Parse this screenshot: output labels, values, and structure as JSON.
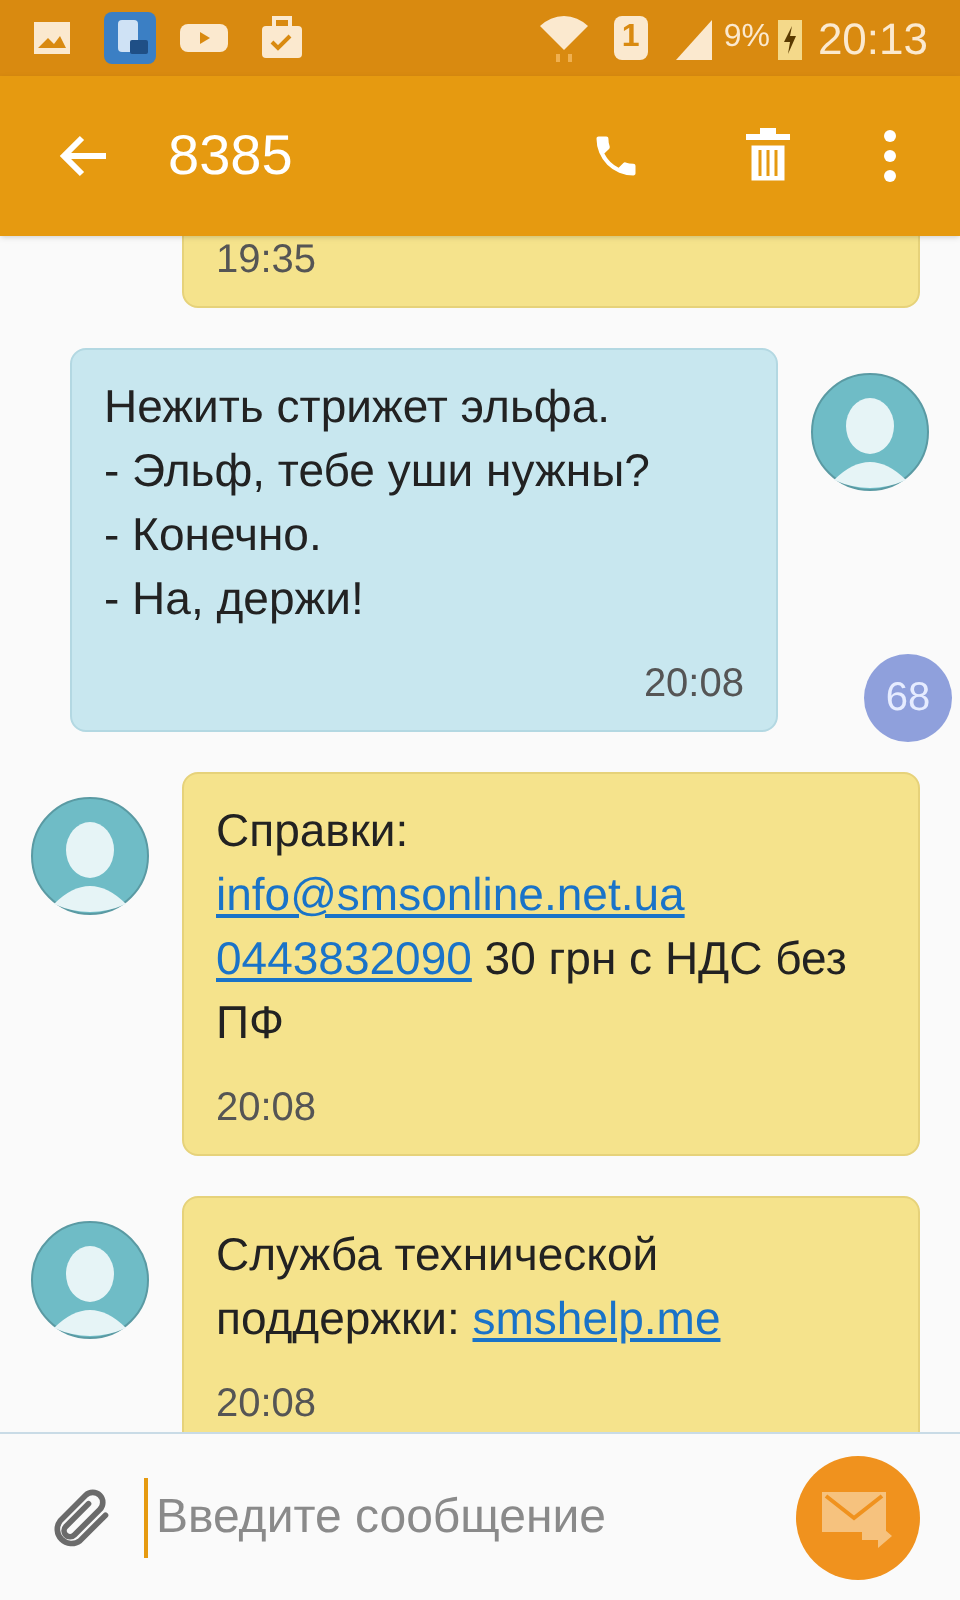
{
  "status_bar": {
    "sim": "1",
    "battery": "9%",
    "time": "20:13"
  },
  "app_bar": {
    "title": "8385"
  },
  "messages": [
    {
      "kind": "incoming",
      "partial": true,
      "time": "19:35"
    },
    {
      "kind": "outgoing",
      "partial": false,
      "lines": [
        [
          {
            "text": "Нежить стрижет эльфа.",
            "link": false
          }
        ],
        [
          {
            "text": "- Эльф, тебе уши нужны?",
            "link": false
          }
        ],
        [
          {
            "text": "- Конечно.",
            "link": false
          }
        ],
        [
          {
            "text": "- На, держи!",
            "link": false
          }
        ]
      ],
      "time": "20:08"
    },
    {
      "kind": "incoming",
      "partial": false,
      "lines": [
        [
          {
            "text": "Справки:",
            "link": false
          }
        ],
        [
          {
            "text": "info@smsonline.net.ua",
            "link": true
          }
        ],
        [
          {
            "text": "0443832090",
            "link": true
          },
          {
            "text": " 30 грн с НДС без ПФ",
            "link": false
          }
        ]
      ],
      "time": "20:08"
    },
    {
      "kind": "incoming",
      "partial": false,
      "lines": [
        [
          {
            "text": "Служба технической поддержки: ",
            "link": false
          },
          {
            "text": "smshelp.me",
            "link": true
          }
        ]
      ],
      "time": "20:08"
    }
  ],
  "scroll_badge": "68",
  "composer": {
    "placeholder": "Введите сообщение"
  }
}
